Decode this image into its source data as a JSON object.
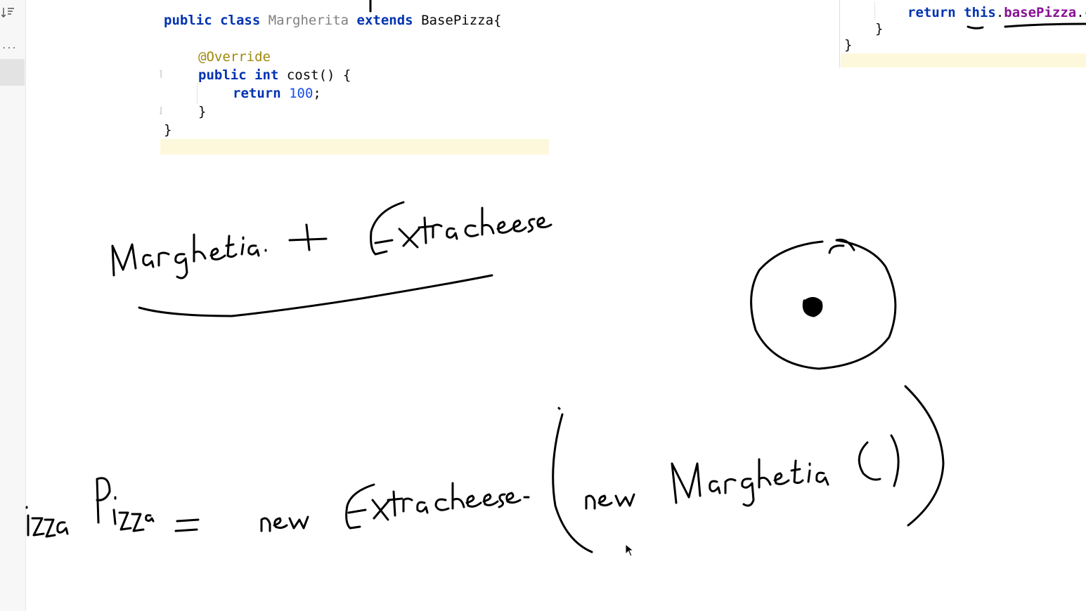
{
  "gutter": {
    "sort_icon": "sort-lines-icon",
    "more_icon": "ellipsis-icon",
    "more_label": "..."
  },
  "editor_left": {
    "lines": [
      {
        "kw": "public class ",
        "name": "Margherita",
        "kw2": " extends ",
        "rest": "BasePizza{"
      },
      {
        "anno": "@Override"
      },
      {
        "kw": "public int ",
        "rest": "cost() {"
      },
      {
        "kw": "return ",
        "num": "100",
        "rest": ";"
      },
      {
        "rest": "}"
      },
      {
        "rest": "}"
      }
    ]
  },
  "editor_right": {
    "line1_kw": "return ",
    "line1_this": "this",
    "line1_dot": ".",
    "line1_field": "basePizza",
    "line1_tail": ".c",
    "line2": "}",
    "line3": "}"
  },
  "handwriting": {
    "top_expression": "Marghetia. + Extracheese",
    "bottom_expression": "izza Pizza = new Extracheese( new Marghetia ( ) )"
  },
  "colors": {
    "ink": "#000000",
    "keyword": "#0033b3",
    "annotation": "#9e880d",
    "number": "#1750eb",
    "field": "#871094",
    "highlight": "#fdf8dc"
  }
}
